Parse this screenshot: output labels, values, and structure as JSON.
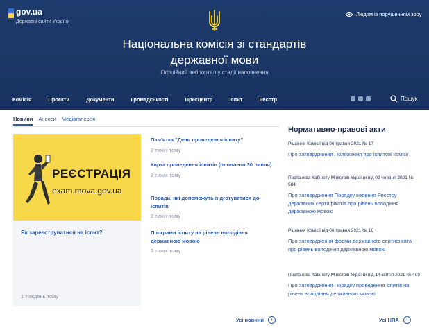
{
  "header": {
    "gov_title": "gov.ua",
    "gov_subtitle": "Державні сайти України",
    "accessibility": "Людям із порушенням зору",
    "title_line1": "Національна комісія зі стандартів",
    "title_line2": "державної мови",
    "subtitle": "Офіційний вебпортал у стадії наповнення",
    "flag_colors": [
      "#2f6fd1",
      "#f6d235"
    ]
  },
  "nav": {
    "items": [
      "Комісія",
      "Проєкти",
      "Документи",
      "Громадськості",
      "Пресцентр",
      "Іспит",
      "Реєстр"
    ],
    "search_label": "Пошук",
    "social_icons": [
      "facebook-icon",
      "telegram-icon",
      "youtube-icon"
    ]
  },
  "tabs": [
    "Новини",
    "Анонси",
    "Медіагалерея"
  ],
  "featured": {
    "promo_title": "РЕЄСТРАЦІЯ",
    "promo_url": "exam.mova.gov.ua",
    "link": "Як зареєструватися на іспит?",
    "date": "1 тиждень тому"
  },
  "news": [
    {
      "title": "Пам'ятка \"День проведення іспиту\"",
      "date": "2 тижні тому"
    },
    {
      "title": "Карта проведення іспитів (оновлено 30 липня)",
      "date": "2 тижні тому"
    },
    {
      "title": "Поради, які допоможуть підготуватися до іспитів",
      "date": "2 тижні тому"
    },
    {
      "title": "Програми іспиту на рівень володіння державною мовою",
      "date": "3 тижні тому"
    }
  ],
  "all_news": "Усі новини",
  "npa": {
    "title": "Нормативно-правові акти",
    "items": [
      {
        "header": "Рішення Комісії від 06 травня 2021 № 17",
        "link": "Про затвердження Положення про іспитові комісії"
      },
      {
        "header": "Постанова Кабінету Міністрів України від 02 червня 2021 № 584",
        "link": "Про затвердження Порядку ведення Реєстру державних сертифікатів про рівень володіння державною мовою"
      },
      {
        "header": "Рішення Комісії від 06 травня 2021 № 16",
        "link": "Про затвердження форми державного сертифіката про рівень володіння державною мовою"
      },
      {
        "header": "Постанова Кабінету Міністрів України від 14 квітня 2021 № 409",
        "link": "Про затвердження Порядку проведення іспитів на рівень володіння державною мовою"
      }
    ],
    "all_label": "Усі НПА"
  },
  "colors": {
    "header_bg": "#1c3a6b",
    "accent": "#2c5aa6",
    "promo_bg": "#f7d84a"
  }
}
